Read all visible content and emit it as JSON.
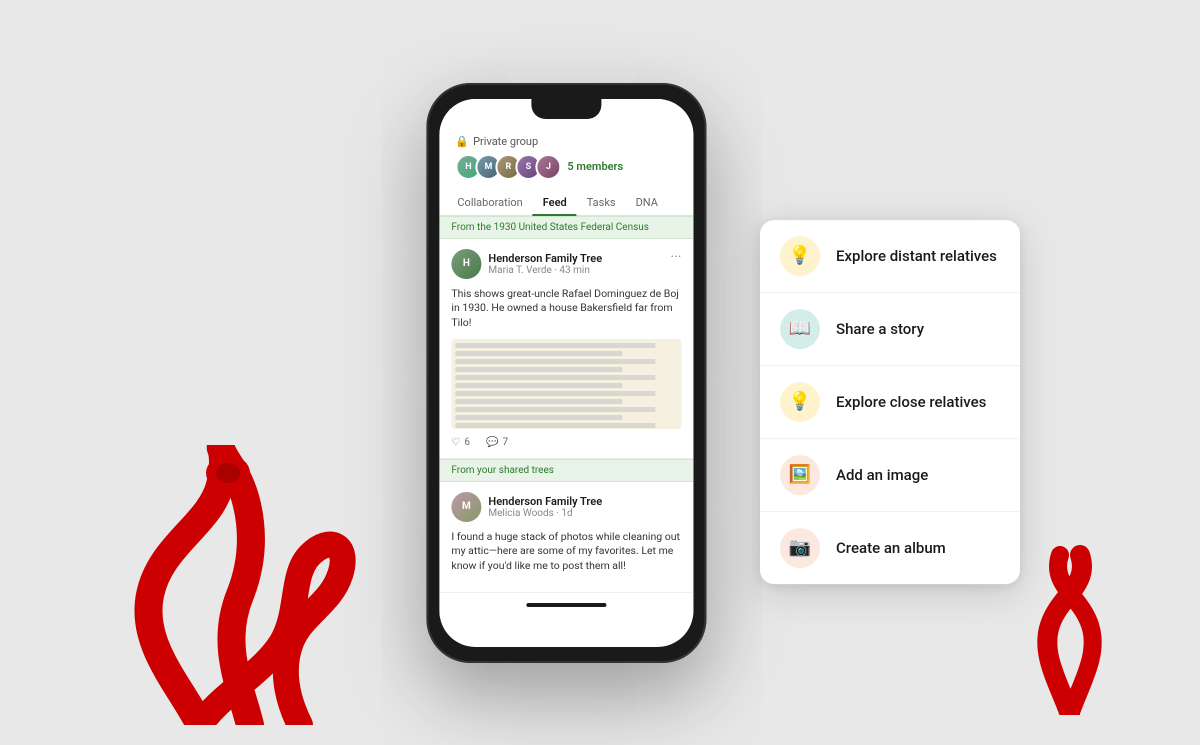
{
  "background_color": "#e8e8e8",
  "phone": {
    "group": {
      "private_label": "Private group",
      "members_count": "5 members",
      "avatars": [
        "H",
        "M",
        "R",
        "S",
        "J"
      ]
    },
    "tabs": [
      {
        "id": "collaboration",
        "label": "Collaboration",
        "active": false
      },
      {
        "id": "feed",
        "label": "Feed",
        "active": true
      },
      {
        "id": "tasks",
        "label": "Tasks",
        "active": false
      },
      {
        "id": "dna",
        "label": "DNA",
        "active": false
      }
    ],
    "feed": {
      "post1": {
        "section_label": "From the 1930 United States Federal Census",
        "group_name": "Henderson Family Tree",
        "user_time": "Maria T. Verde · 43 min",
        "text": "This shows great-uncle Rafael Dominguez de Boj in 1930. He owned a house Bakersfield far from Tilo!",
        "likes": "6",
        "comments": "7"
      },
      "post2": {
        "section_label": "From your shared trees",
        "group_name": "Henderson Family Tree",
        "user_time": "Melicia Woods · 1d",
        "text": "I found a huge stack of photos while cleaning out my attic—here are some of my favorites. Let me know if you'd like me to post them all!"
      }
    }
  },
  "dropdown": {
    "items": [
      {
        "id": "explore-distant",
        "label": "Explore distant relatives",
        "icon": "💡",
        "icon_bg": "yellow"
      },
      {
        "id": "share-story",
        "label": "Share a story",
        "icon": "📖",
        "icon_bg": "teal"
      },
      {
        "id": "explore-close",
        "label": "Explore close relatives",
        "icon": "💡",
        "icon_bg": "yellow"
      },
      {
        "id": "add-image",
        "label": "Add an image",
        "icon": "🖼️",
        "icon_bg": "pink"
      },
      {
        "id": "create-album",
        "label": "Create an album",
        "icon": "📷",
        "icon_bg": "pink"
      }
    ]
  }
}
